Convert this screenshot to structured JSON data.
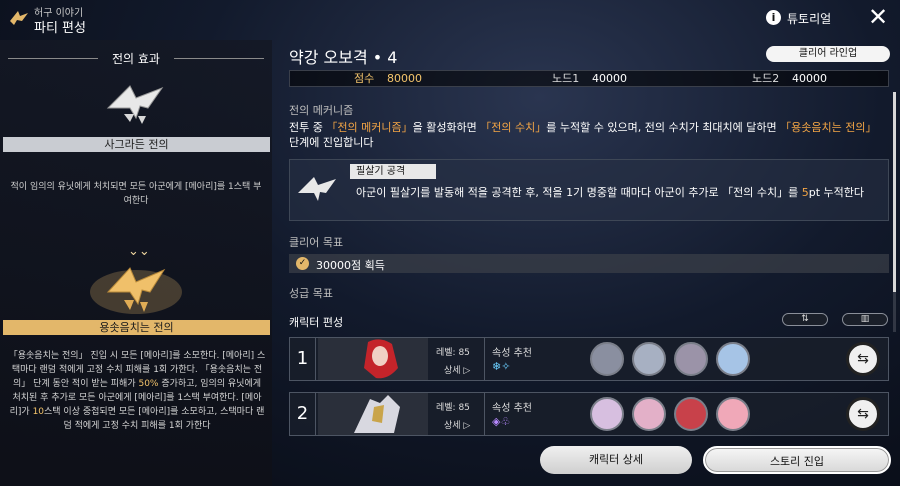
{
  "header": {
    "subtitle": "허구 이야기",
    "title": "파티 편성"
  },
  "left": {
    "section_title": "전의 효과",
    "effect1": {
      "name": "사그라든 전의",
      "desc": "적이 임의의 유닛에게 처치되면 모든 아군에게 [메아리]를 1스택 부여한다"
    },
    "arrow": "⌄⌄",
    "effect2": {
      "name": "용솟음치는 전의",
      "desc_a": "「용솟음치는 전의」 진입 시 모든 [메아리]를 소모한다. [메아리] 스택마다 랜덤 적에게 고정 수치 피해를 1회 가한다. 「용솟음치는 전의」 단계 동안 적이 받는 피해가 ",
      "desc_pct": "50%",
      "desc_b": " 증가하고, 임의의 유닛에게 처치된 후 추가로 모든 아군에게 [메아리]를 1스택 부여한다. [메아리]가 ",
      "desc_stack": "10",
      "desc_c": "스택 이상 중첩되면 모든 [메아리]를 소모하고, 스택마다 랜덤 적에게 고정 수치 피해를 1회 가한다"
    }
  },
  "topbar": {
    "tutorial_label": "튜토리얼",
    "tutorial_icon": "info-icon",
    "close_icon": "close-icon"
  },
  "stage": {
    "title": "약강 오보격 • 4",
    "clear_lineup_label": "클리어 라인업",
    "score_label": "점수",
    "score_value": "80000",
    "node1_label": "노드1",
    "node1_value": "40000",
    "node2_label": "노드2",
    "node2_value": "40000"
  },
  "mechanism": {
    "heading": "전의 메커니즘",
    "t1": "전투 중 ",
    "k1": "「전의 메커니즘」",
    "t2": "을 활성화하면 ",
    "k2": "「전의 수치」",
    "t3": "를 누적할 수 있으며, 전의 수치가 최대치에 달하면 ",
    "k3": "「용솟음치는 전의」",
    "t4": " 단계에 진입합니다"
  },
  "skill": {
    "tag": "필살기 공격",
    "t1": "아군이 필살기를 발동해 적을 공격한 후, 적을 1기 명중할 때마다 아군이 추가로 「전의 수치」를 ",
    "k1": "5",
    "t2": "pt 누적한다"
  },
  "clear": {
    "heading": "클리어 목표",
    "goal": "30000점 획득",
    "check_icon": "check-icon"
  },
  "star": {
    "heading": "성급 목표"
  },
  "team": {
    "heading": "캐릭터 편성",
    "swap_btn_icon": "swap-icon",
    "delete_btn_icon": "trash-icon",
    "rows": [
      {
        "num": "1",
        "level": "레벨: 85",
        "detail": "상세",
        "rec_label": "속성 추천",
        "elements": "❄✧",
        "swap_icon": "swap-icon"
      },
      {
        "num": "2",
        "level": "레벨: 85",
        "detail": "상세",
        "rec_label": "속성 추천",
        "elements": "◈♧",
        "swap_icon": "swap-icon"
      }
    ]
  },
  "buttons": {
    "character_detail": "캐릭터 상세",
    "story_enter": "스토리 진입"
  },
  "colors": {
    "accent_gold": "#e3b76a",
    "keyword_orange": "#f3a545",
    "highlight": "#f3c46b"
  }
}
